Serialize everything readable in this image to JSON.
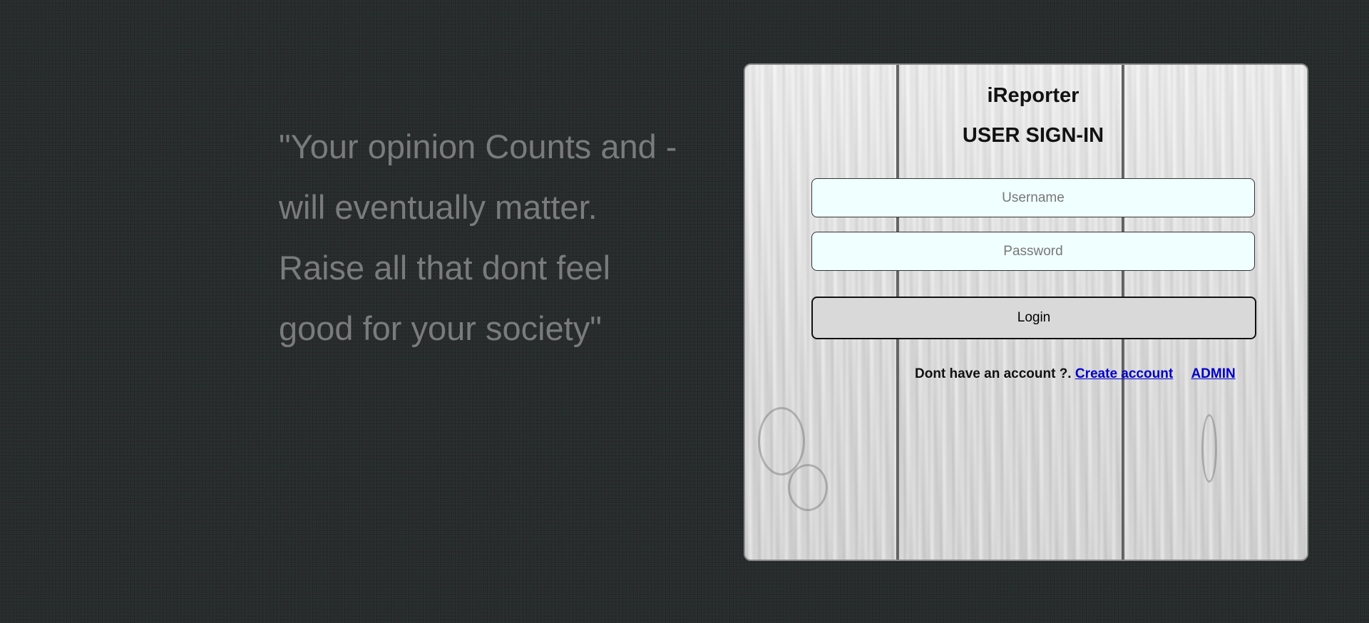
{
  "quote": {
    "lines": [
      "\"Your opinion Counts and -",
      "will eventually matter.",
      "Raise all that dont feel",
      "good for your society\""
    ]
  },
  "signin": {
    "app_title": "iReporter",
    "form_title": "USER SIGN-IN",
    "username_placeholder": "Username",
    "password_placeholder": "Password",
    "login_label": "Login",
    "no_account_text": "Dont have an account ?.",
    "create_account_label": "Create account",
    "admin_label": "ADMIN"
  },
  "colors": {
    "background": "#262b2b",
    "quote_text": "#7a7c7c",
    "input_bg": "#f0ffff",
    "button_bg": "#d9d9d9",
    "link": "#0000cc"
  }
}
